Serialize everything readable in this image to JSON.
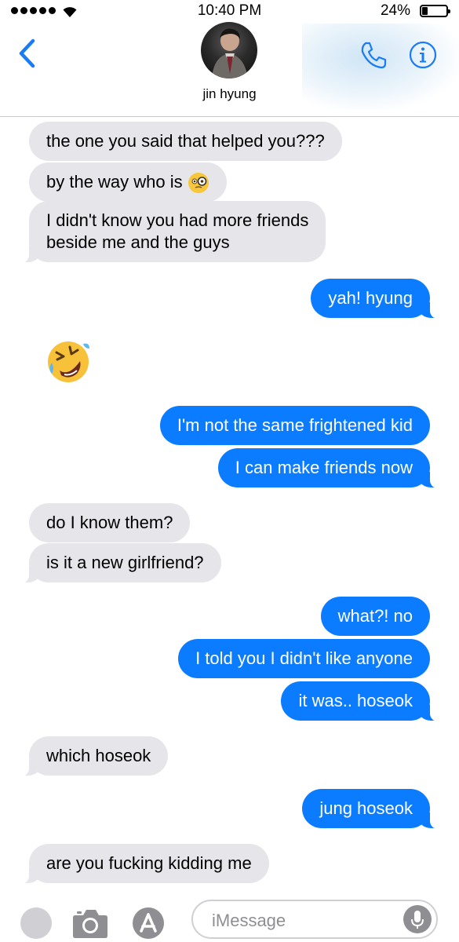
{
  "status_bar": {
    "time": "10:40 PM",
    "battery": "24%",
    "battery_level": 0.24,
    "icons": [
      "signal-dots-icon",
      "wifi-icon",
      "battery-icon"
    ]
  },
  "header": {
    "contact_name": "jin hyung",
    "back_icon": "chevron-left-icon",
    "call_icon": "phone-icon",
    "info_icon": "info-icon",
    "accent_color": "#1a7cf4"
  },
  "messages": [
    {
      "from": "them",
      "text": "the one you said that helped you???"
    },
    {
      "from": "them",
      "text": "by the way who is",
      "emoji": "face-with-monocle"
    },
    {
      "from": "them",
      "lines": [
        "I didn't know you had more friends",
        "beside me and the guys"
      ]
    },
    {
      "from": "me",
      "text": "yah! hyung"
    },
    {
      "from": "them",
      "emoji": "rolling-on-the-floor-laughing"
    },
    {
      "from": "me",
      "text": "I'm not the same frightened kid"
    },
    {
      "from": "me",
      "text": "I can make friends now"
    },
    {
      "from": "them",
      "text": "do I know them?"
    },
    {
      "from": "them",
      "text": "is it a new girlfriend?"
    },
    {
      "from": "me",
      "text": "what?! no"
    },
    {
      "from": "me",
      "text": "I told you I didn't like anyone"
    },
    {
      "from": "me",
      "text": "it was.. hoseok"
    },
    {
      "from": "them",
      "text": "which hoseok"
    },
    {
      "from": "me",
      "text": "jung hoseok"
    },
    {
      "from": "them",
      "text": "are you fucking kidding me"
    }
  ],
  "colors": {
    "incoming_bubble": "#e5e5ea",
    "outgoing_bubble": "#0b7cff"
  },
  "input_bar": {
    "placeholder": "iMessage",
    "icons": [
      "apps-icon",
      "camera-icon",
      "app-store-icon",
      "microphone-icon"
    ]
  }
}
